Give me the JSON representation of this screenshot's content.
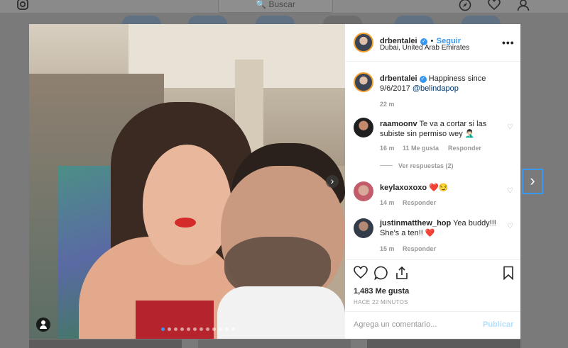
{
  "topbar": {
    "search_placeholder": "🔍 Buscar",
    "icons": [
      "instagram-icon",
      "explore-icon",
      "heart-icon",
      "profile-icon"
    ]
  },
  "post": {
    "username": "drbentalei",
    "follow_label": "Seguir",
    "location": "Dubai, United Arab Emirates",
    "more_label": "•••",
    "caption": {
      "user": "drbentalei",
      "text": "Happiness since 9/6/2017 ",
      "mention": "@belindapop",
      "time": "22 m"
    },
    "comments": [
      {
        "user": "raamoonv",
        "text": "Te va a cortar si las subiste sin permiso wey 🤦🏻‍♂️",
        "time": "16 m",
        "likes": "11 Me gusta",
        "reply": "Responder",
        "view_replies": "Ver respuestas (2)"
      },
      {
        "user": "keylaxoxoxo",
        "text": "❤️😏",
        "time": "14 m",
        "reply": "Responder"
      },
      {
        "user": "justinmatthew_hop",
        "text": "Yea buddy!!! She's a ten!! ❤️",
        "time": "15 m",
        "reply": "Responder"
      }
    ],
    "likes_count": "1,483 Me gusta",
    "timestamp": "HACE 22 MINUTOS",
    "comment_placeholder": "Agrega un comentario...",
    "publish_label": "Publicar",
    "carousel": {
      "total": 12,
      "active": 1
    }
  },
  "colors": {
    "accent": "#3897f0",
    "text": "#262626",
    "muted": "#999999",
    "overlay": "#7a7a7a"
  }
}
